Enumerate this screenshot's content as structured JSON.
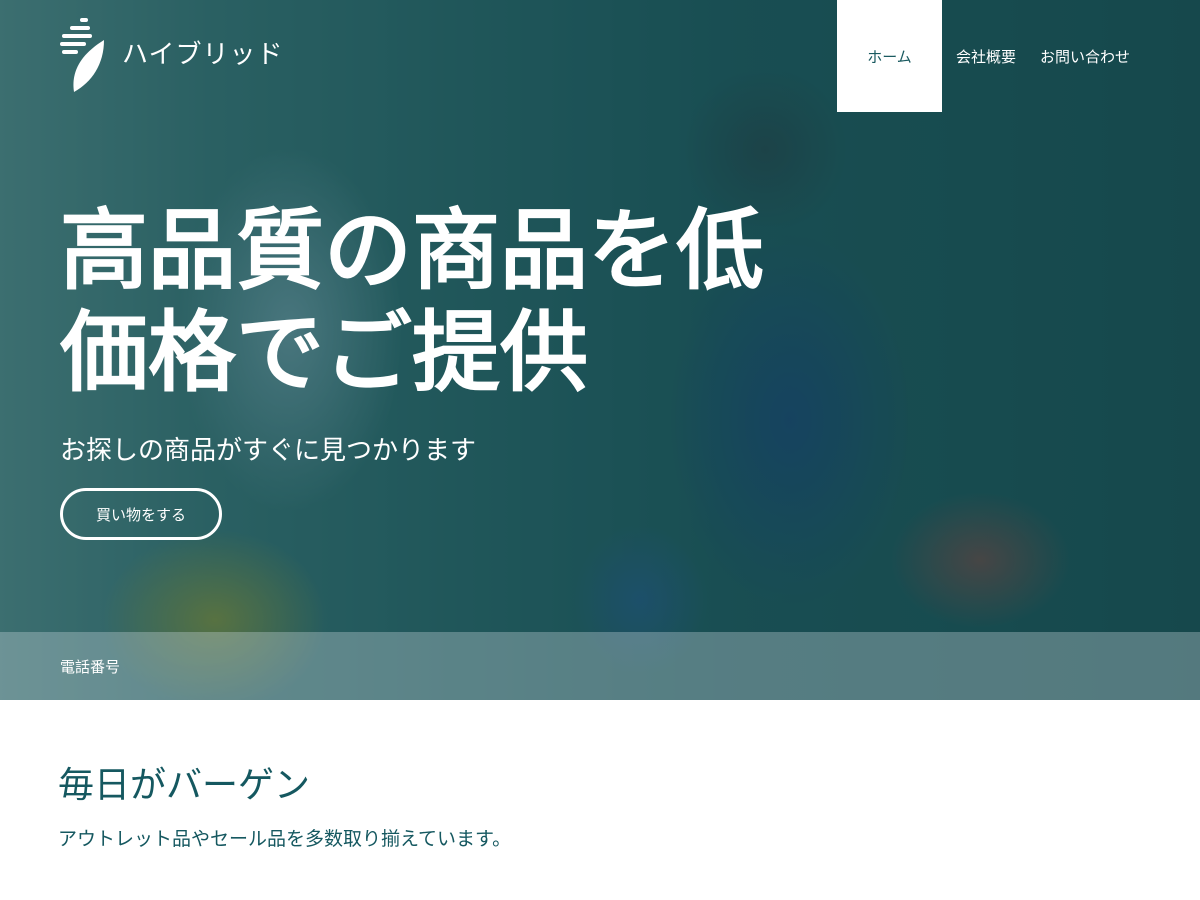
{
  "brand": {
    "name": "ハイブリッド",
    "logo_icon": "leaf-stripes-icon"
  },
  "nav": {
    "items": [
      {
        "label": "ホーム",
        "active": true
      },
      {
        "label": "会社概要",
        "active": false
      },
      {
        "label": "お問い合わせ",
        "active": false
      }
    ]
  },
  "hero": {
    "headline": "高品質の商品を低価格でご提供",
    "subhead": "お探しの商品がすぐに見つかります",
    "cta_label": "買い物をする",
    "phone_label": "電話番号"
  },
  "section": {
    "title": "毎日がバーゲン",
    "body": "アウトレット品やセール品を多数取り揃えています。"
  },
  "colors": {
    "accent": "#155860",
    "overlay": "#124e54",
    "white": "#ffffff"
  }
}
